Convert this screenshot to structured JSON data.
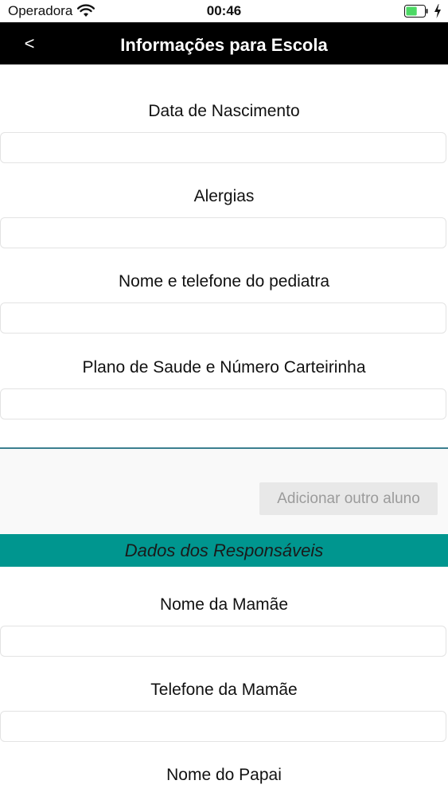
{
  "status_bar": {
    "carrier": "Operadora",
    "time": "00:46",
    "battery_level": 0.6,
    "wifi_icon": "wifi-icon",
    "battery_icon": "battery-icon",
    "charging_icon": "bolt-icon"
  },
  "nav": {
    "back_label": "<",
    "title": "Informações para Escola"
  },
  "student_fields": [
    {
      "label": "Data de Nascimento",
      "value": "",
      "placeholder": ""
    },
    {
      "label": "Alergias",
      "value": "",
      "placeholder": ""
    },
    {
      "label": "Nome e telefone do pediatra",
      "value": "",
      "placeholder": ""
    },
    {
      "label": "Plano de Saude e Número Carteirinha",
      "value": "",
      "placeholder": ""
    }
  ],
  "add_student_button": "Adicionar outro aluno",
  "guardians_section": {
    "title": "Dados dos Responsáveis",
    "fields": [
      {
        "label": "Nome da Mamãe",
        "value": "",
        "placeholder": ""
      },
      {
        "label": "Telefone da Mamãe",
        "value": "",
        "placeholder": ""
      },
      {
        "label": "Nome do Papai",
        "value": "",
        "placeholder": ""
      }
    ]
  },
  "colors": {
    "nav_background": "#000000",
    "section_header": "#00968f",
    "divider": "#3b7f8f",
    "button_disabled_bg": "#e8e8e8",
    "button_disabled_text": "#9b9b9b",
    "battery_fill": "#4cd964"
  }
}
